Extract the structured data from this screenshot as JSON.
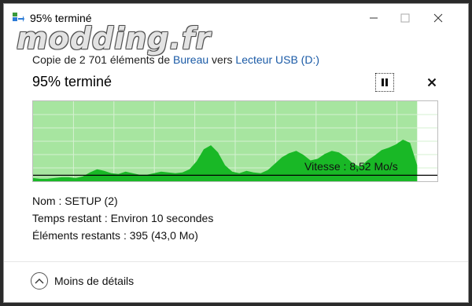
{
  "window": {
    "title": "95% terminé",
    "watermark": "modding.fr"
  },
  "header": {
    "copy_prefix": "Copie de 2 701 éléments de ",
    "source": "Bureau",
    "copy_middle": " vers ",
    "destination": "Lecteur USB (D:)"
  },
  "progress": {
    "title": "95% terminé",
    "percent": 95
  },
  "speed": {
    "label": "Vitesse : 8,52 Mo/s"
  },
  "details": {
    "name_label": "Nom :",
    "name_value": "SETUP (2)",
    "time_label": "Temps restant :",
    "time_value": "Environ 10 secondes",
    "items_label": "Éléments restants :",
    "items_value": "395 (43,0 Mo)"
  },
  "footer": {
    "less_details": "Moins de détails"
  },
  "colors": {
    "graph_bg": "#a7e5a0",
    "graph_fill": "#19b826",
    "grid": "#d6f1d2",
    "speed_line": "#000000",
    "link": "#1a5aa6"
  },
  "chart_data": {
    "type": "area",
    "y": [
      0.04,
      0.03,
      0.03,
      0.04,
      0.05,
      0.05,
      0.04,
      0.06,
      0.11,
      0.15,
      0.13,
      0.1,
      0.09,
      0.12,
      0.1,
      0.08,
      0.08,
      0.1,
      0.12,
      0.11,
      0.1,
      0.11,
      0.15,
      0.25,
      0.4,
      0.45,
      0.36,
      0.2,
      0.12,
      0.1,
      0.13,
      0.11,
      0.1,
      0.14,
      0.22,
      0.3,
      0.35,
      0.38,
      0.33,
      0.26,
      0.28,
      0.34,
      0.38,
      0.36,
      0.3,
      0.22,
      0.18,
      0.26,
      0.32,
      0.39,
      0.42,
      0.46,
      0.52,
      0.48,
      0.2
    ],
    "current_speed_level": 0.075
  }
}
